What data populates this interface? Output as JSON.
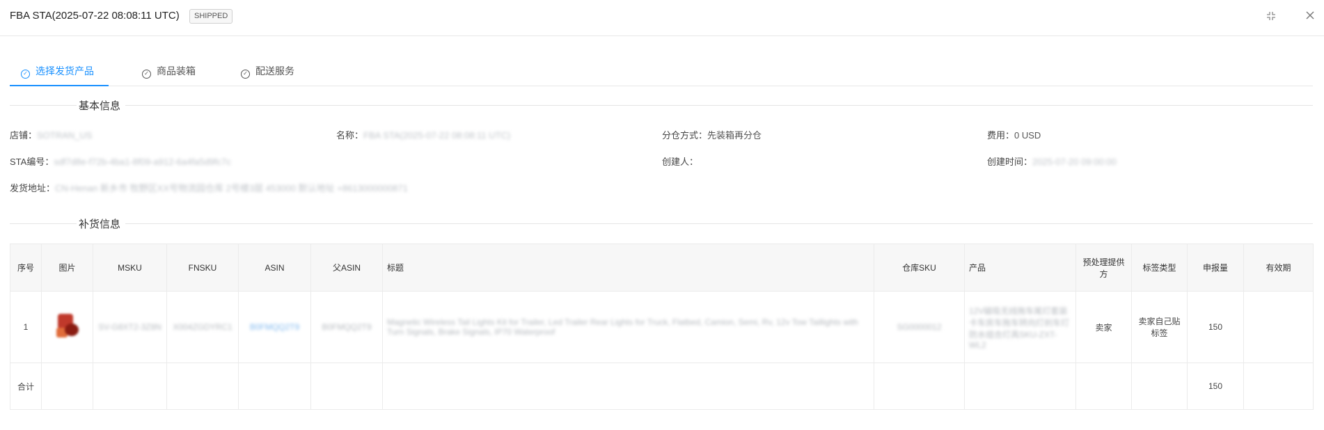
{
  "header": {
    "title": "FBA STA(2025-07-22 08:08:11 UTC)",
    "status_badge": "SHIPPED"
  },
  "tabs": [
    {
      "label": "选择发货产品",
      "active": true
    },
    {
      "label": "商品装箱",
      "active": false
    },
    {
      "label": "配送服务",
      "active": false
    }
  ],
  "basic_info": {
    "section_title": "基本信息",
    "store_label": "店铺：",
    "store_value": "SOTRAN_US",
    "name_label": "名称：",
    "name_value": "FBA STA(2025-07-22 08:08:11 UTC)",
    "split_label": "分仓方式：",
    "split_value": "先装箱再分仓",
    "fee_label": "费用：",
    "fee_value": "0 USD",
    "sta_label": "STA编号：",
    "sta_value": "sdf7d8e-f72b-4ba1-8f09-a912-6a4fa5d9fc7c",
    "creator_label": "创建人：",
    "creator_value": "",
    "created_label": "创建时间：",
    "created_value": "2025-07-20 09:00:00",
    "address_label": "发货地址：",
    "address_value": "CN-Henan 新乡市 牧野区XX号物流园仓库 2号楼3层 453000 默认地址 +8613000000871"
  },
  "replenish": {
    "section_title": "补货信息",
    "columns": [
      "序号",
      "图片",
      "MSKU",
      "FNSKU",
      "ASIN",
      "父ASIN",
      "标题",
      "仓库SKU",
      "产品",
      "预处理提供方",
      "标签类型",
      "申报量",
      "有效期"
    ],
    "rows": [
      {
        "index": "1",
        "msku": "SV-G8XT2-3Z8N",
        "fnsku": "X004ZGDYRC1",
        "asin": "B0FMQQ2T9",
        "parent_asin": "B0FMQQ2T9",
        "title": "Magnetic Wireless Tail Lights Kit for Trailer, Led Trailer Rear Lights for Truck, Flatbed, Camion, Semi, Rv, 12v Tow Taillights with Turn Signals, Brake Signals, IP70 Waterproof",
        "warehouse_sku": "SG0000012",
        "product": "12V磁吸无线拖车尾灯套装卡车房车拖车转向灯刹车灯防水组合灯具SKU-ZXT-WL2",
        "prep_provider": "卖家",
        "label_type": "卖家自己贴标签",
        "declared_qty": "150",
        "expiry": ""
      }
    ],
    "total": {
      "label": "合计",
      "declared_qty": "150"
    }
  }
}
